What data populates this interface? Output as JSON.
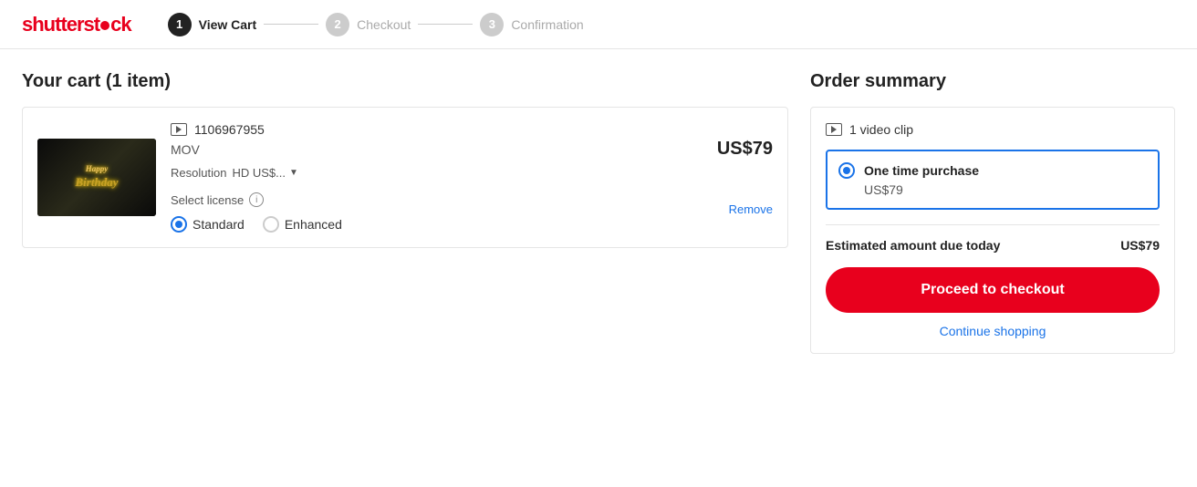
{
  "header": {
    "logo": "shutterstock",
    "steps": [
      {
        "number": "1",
        "label": "View Cart",
        "state": "active"
      },
      {
        "number": "2",
        "label": "Checkout",
        "state": "inactive"
      },
      {
        "number": "3",
        "label": "Confirmation",
        "state": "inactive"
      }
    ]
  },
  "cart": {
    "title": "Your cart (1 item)",
    "item": {
      "id": "1106967955",
      "format": "MOV",
      "resolution_label": "Resolution",
      "resolution_value": "HD US$...",
      "price": "US$79",
      "license_label": "Select license",
      "license_standard": "Standard",
      "license_enhanced": "Enhanced",
      "remove_label": "Remove",
      "thumbnail_line1": "Happy",
      "thumbnail_line2": "Birthday"
    }
  },
  "order_summary": {
    "title": "Order summary",
    "video_count": "1 video clip",
    "purchase_option": "One time purchase",
    "purchase_price": "US$79",
    "estimated_label": "Estimated amount due today",
    "estimated_amount": "US$79",
    "checkout_label": "Proceed to checkout",
    "continue_label": "Continue shopping"
  },
  "icons": {
    "video": "▶",
    "info": "i",
    "dropdown_arrow": "▼"
  }
}
